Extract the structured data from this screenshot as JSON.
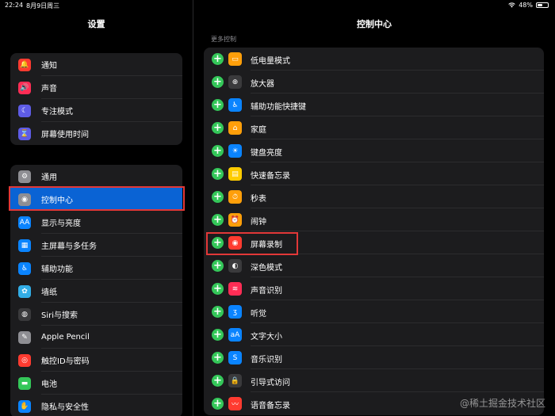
{
  "status": {
    "time": "22:24",
    "date": "8月9日周三",
    "battery": "48%",
    "battery_level": 0.48
  },
  "left": {
    "title": "设置",
    "group1": [
      {
        "label": "通知",
        "icon": "bell-icon",
        "color": "#ff3b30",
        "glyph": "🔔"
      },
      {
        "label": "声音",
        "icon": "speaker-icon",
        "color": "#ff2d55",
        "glyph": "🔊"
      },
      {
        "label": "专注模式",
        "icon": "moon-icon",
        "color": "#5e5ce6",
        "glyph": "☾"
      },
      {
        "label": "屏幕使用时间",
        "icon": "hourglass-icon",
        "color": "#5e5ce6",
        "glyph": "⌛"
      }
    ],
    "group2": [
      {
        "label": "通用",
        "icon": "gear-icon",
        "color": "#8e8e93",
        "glyph": "⚙"
      },
      {
        "label": "控制中心",
        "icon": "toggles-icon",
        "color": "#8e8e93",
        "glyph": "◉",
        "selected": true
      },
      {
        "label": "显示与亮度",
        "icon": "text-size-icon",
        "color": "#0a84ff",
        "glyph": "AA"
      },
      {
        "label": "主屏幕与多任务",
        "icon": "grid-icon",
        "color": "#0a84ff",
        "glyph": "▦"
      },
      {
        "label": "辅助功能",
        "icon": "accessibility-icon",
        "color": "#0a84ff",
        "glyph": "♿"
      },
      {
        "label": "墙纸",
        "icon": "flower-icon",
        "color": "#32ade6",
        "glyph": "✿"
      },
      {
        "label": "Siri与搜索",
        "icon": "siri-icon",
        "color": "#3a3a3c",
        "glyph": "◍"
      },
      {
        "label": "Apple Pencil",
        "icon": "pencil-icon",
        "color": "#8e8e93",
        "glyph": "✎"
      },
      {
        "label": "触控ID与密码",
        "icon": "fingerprint-icon",
        "color": "#ff3b30",
        "glyph": "◎"
      },
      {
        "label": "电池",
        "icon": "battery-icon",
        "color": "#34c759",
        "glyph": "▬"
      },
      {
        "label": "隐私与安全性",
        "icon": "hand-icon",
        "color": "#0a84ff",
        "glyph": "✋"
      }
    ]
  },
  "right": {
    "title": "控制中心",
    "section_label": "更多控制",
    "items": [
      {
        "label": "低电量模式",
        "icon": "battery-low-icon",
        "color": "#ff9f0a",
        "glyph": "▭"
      },
      {
        "label": "放大器",
        "icon": "magnifier-icon",
        "color": "#3a3a3c",
        "glyph": "⊕"
      },
      {
        "label": "辅助功能快捷键",
        "icon": "accessibility-icon",
        "color": "#0a84ff",
        "glyph": "♿"
      },
      {
        "label": "家庭",
        "icon": "home-icon",
        "color": "#ff9f0a",
        "glyph": "⌂"
      },
      {
        "label": "键盘亮度",
        "icon": "keyboard-brightness-icon",
        "color": "#0a84ff",
        "glyph": "☀"
      },
      {
        "label": "快速备忘录",
        "icon": "note-icon",
        "color": "#ffcc00",
        "glyph": "▤"
      },
      {
        "label": "秒表",
        "icon": "stopwatch-icon",
        "color": "#ff9f0a",
        "glyph": "⏱"
      },
      {
        "label": "闹钟",
        "icon": "alarm-icon",
        "color": "#ff9f0a",
        "glyph": "⏰"
      },
      {
        "label": "屏幕录制",
        "icon": "record-icon",
        "color": "#ff3b30",
        "glyph": "◉"
      },
      {
        "label": "深色模式",
        "icon": "dark-mode-icon",
        "color": "#3a3a3c",
        "glyph": "◐"
      },
      {
        "label": "声音识别",
        "icon": "sound-recognition-icon",
        "color": "#ff2d55",
        "glyph": "≋"
      },
      {
        "label": "听觉",
        "icon": "ear-icon",
        "color": "#0a84ff",
        "glyph": "ʒ"
      },
      {
        "label": "文字大小",
        "icon": "text-size-icon",
        "color": "#0a84ff",
        "glyph": "aA"
      },
      {
        "label": "音乐识别",
        "icon": "shazam-icon",
        "color": "#0a84ff",
        "glyph": "S"
      },
      {
        "label": "引导式访问",
        "icon": "lock-icon",
        "color": "#3a3a3c",
        "glyph": "🔒"
      },
      {
        "label": "语音备忘录",
        "icon": "voice-memo-icon",
        "color": "#ff3b30",
        "glyph": "〰"
      }
    ],
    "add_glyph": "+"
  },
  "watermark": "@稀土掘金技术社区"
}
